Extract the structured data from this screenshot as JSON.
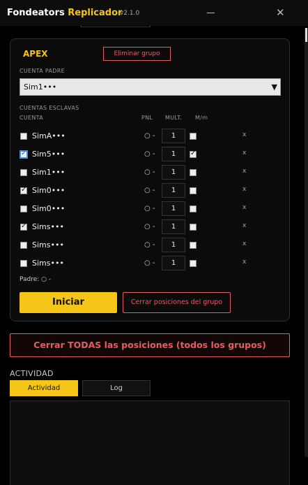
{
  "app": {
    "title_main": "Fondeators",
    "title_accent": "Replicador",
    "version": "v2.1.0",
    "minimize": "",
    "close": "✕"
  },
  "group": {
    "name": "APEX",
    "delete_label": "Eliminar grupo",
    "parent_label": "CUENTA PADRE",
    "parent_value": "Sim1•••",
    "slaves_label": "CUENTAS ESCLAVAS",
    "columns": {
      "account": "CUENTA",
      "pnl": "PNL",
      "mult": "MULT.",
      "mm": "M/m"
    },
    "slaves": [
      {
        "account": "SimA•••",
        "checked": false,
        "pnl": "○ -",
        "mult": "1",
        "mm": false,
        "remove": "x"
      },
      {
        "account": "Sim5•••",
        "checked": true,
        "pnl": "○ -",
        "mult": "1",
        "mm": true,
        "remove": "x"
      },
      {
        "account": "Sim1•••",
        "checked": false,
        "pnl": "○ -",
        "mult": "1",
        "mm": false,
        "remove": "x"
      },
      {
        "account": "Sim0•••",
        "checked": true,
        "pnl": "○ -",
        "mult": "1",
        "mm": false,
        "remove": "x"
      },
      {
        "account": "Sim0•••",
        "checked": false,
        "pnl": "○ -",
        "mult": "1",
        "mm": false,
        "remove": "x"
      },
      {
        "account": "Sims•••",
        "checked": true,
        "pnl": "○ -",
        "mult": "1",
        "mm": false,
        "remove": "x"
      },
      {
        "account": "Sims•••",
        "checked": false,
        "pnl": "○ -",
        "mult": "1",
        "mm": false,
        "remove": "x"
      },
      {
        "account": "Sims•••",
        "checked": false,
        "pnl": "○ -",
        "mult": "1",
        "mm": false,
        "remove": "x"
      }
    ],
    "padre_status": "Padre: ○ -",
    "start_label": "Iniciar",
    "close_group_label": "Cerrar posiciones del grupo"
  },
  "close_all_label": "Cerrar TODAS las posiciones (todos los grupos)",
  "activity": {
    "title": "ACTIVIDAD",
    "tabs": [
      "Actividad",
      "Log"
    ]
  },
  "colors": {
    "accent": "#f5c518",
    "danger": "#e06060",
    "background": "#000000"
  }
}
